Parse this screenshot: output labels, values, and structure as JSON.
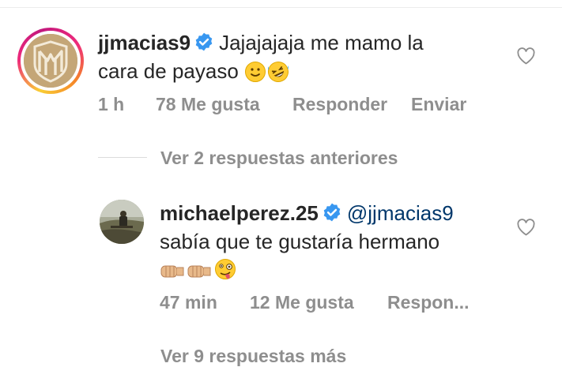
{
  "comment1": {
    "username": "jjmacias9",
    "text_line1": "Jajajajaja me mamo la",
    "text_line2": "cara de payaso",
    "emojis": [
      "slightly-smiling-face-emoji",
      "rolling-on-floor-laughing-emoji"
    ],
    "time": "1 h",
    "likes": "78 Me gusta",
    "reply_label": "Responder",
    "send_label": "Enviar"
  },
  "replies_toggle": {
    "label": "Ver 2 respuestas anteriores"
  },
  "reply1": {
    "username": "michaelperez.25",
    "mention": "@jjmacias9",
    "text_line2": "sabía que te gustaría hermano",
    "emojis": [
      "fist-bump-emoji",
      "fist-bump-emoji",
      "zany-face-emoji"
    ],
    "time": "47 min",
    "likes": "12 Me gusta",
    "reply_label": "Respon..."
  },
  "more_replies": {
    "label": "Ver 9 respuestas más"
  },
  "colors": {
    "text": "#262626",
    "secondary": "#8e8e8e",
    "verified": "#3897f0",
    "mention": "#00376b",
    "divider": "#dbdbdb"
  }
}
